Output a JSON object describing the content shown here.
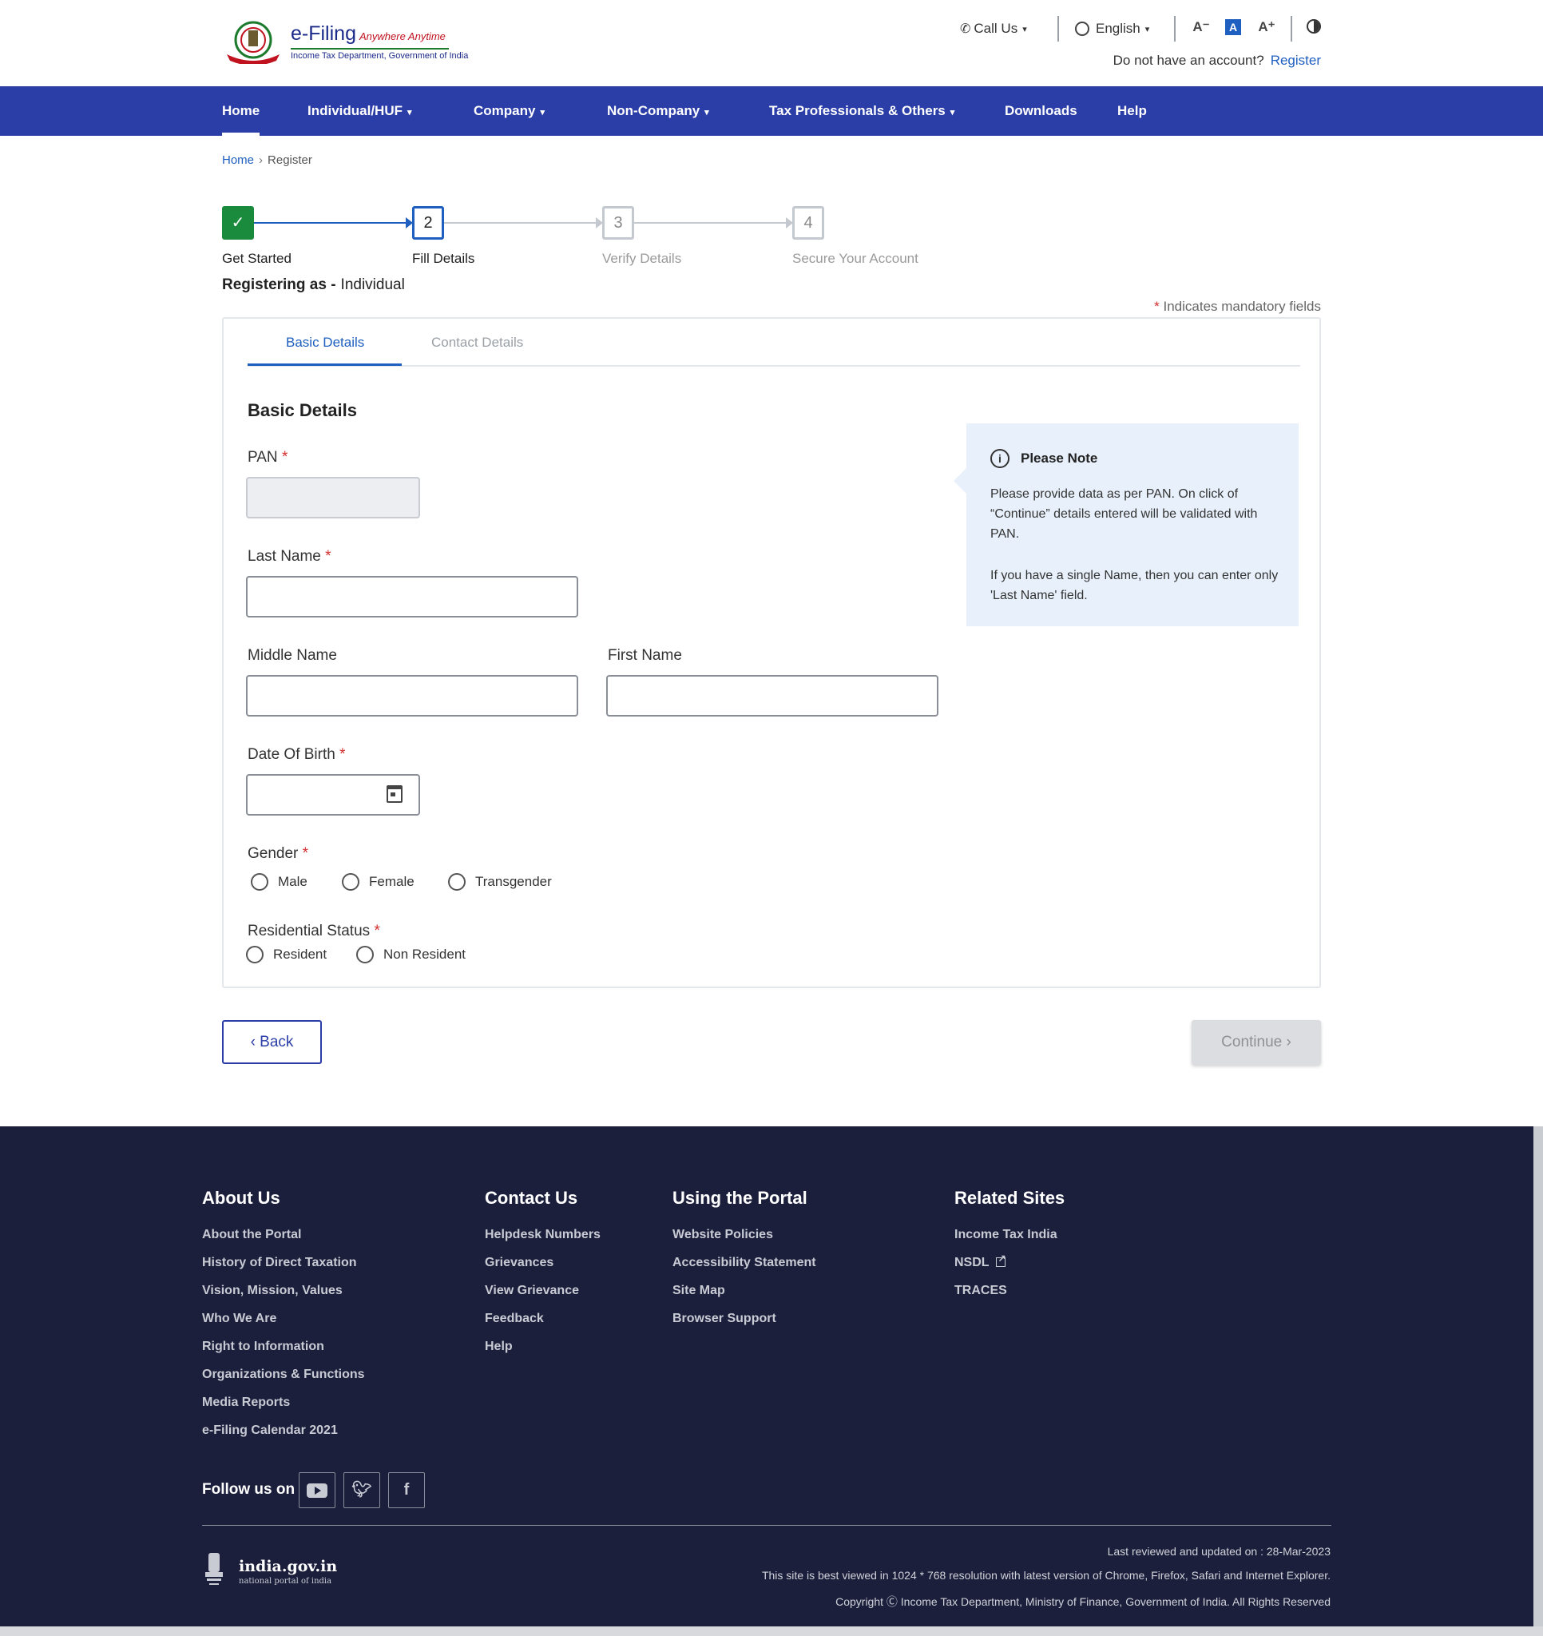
{
  "header": {
    "brand": "e-Filing",
    "tagline": "Anywhere Anytime",
    "subtitle": "Income Tax Department, Government of India",
    "call_us": "Call Us",
    "language": "English",
    "font_decrease": "A⁻",
    "font_normal": "A",
    "font_increase": "A⁺",
    "account_prompt": "Do not have an account?",
    "register_link": "Register"
  },
  "nav": {
    "items": [
      {
        "label": "Home",
        "active": true
      },
      {
        "label": "Individual/HUF",
        "dropdown": true
      },
      {
        "label": "Company",
        "dropdown": true
      },
      {
        "label": "Non-Company",
        "dropdown": true
      },
      {
        "label": "Tax Professionals & Others",
        "dropdown": true
      },
      {
        "label": "Downloads"
      },
      {
        "label": "Help"
      }
    ]
  },
  "breadcrumb": {
    "home": "Home",
    "separator": "›",
    "current": "Register"
  },
  "stepper": {
    "steps": [
      {
        "number": "✓",
        "label": "Get Started",
        "state": "done"
      },
      {
        "number": "2",
        "label": "Fill Details",
        "state": "current"
      },
      {
        "number": "3",
        "label": "Verify Details",
        "state": "pending"
      },
      {
        "number": "4",
        "label": "Secure Your Account",
        "state": "pending"
      }
    ]
  },
  "registering": {
    "prefix": "Registering as -",
    "type": "Individual"
  },
  "mandatory_note": {
    "star": "*",
    "text": "Indicates mandatory fields"
  },
  "tabs": {
    "basic": "Basic Details",
    "contact": "Contact Details"
  },
  "form": {
    "section_title": "Basic Details",
    "required_star": "*",
    "pan_label": "PAN",
    "pan_value": "",
    "last_name_label": "Last Name",
    "last_name_value": "",
    "middle_name_label": "Middle Name",
    "middle_name_value": "",
    "first_name_label": "First Name",
    "first_name_value": "",
    "dob_label": "Date Of Birth",
    "dob_value": "",
    "gender_label": "Gender",
    "gender_options": [
      "Male",
      "Female",
      "Transgender"
    ],
    "residential_label": "Residential Status",
    "residential_options": [
      "Resident",
      "Non Resident"
    ]
  },
  "note": {
    "icon": "i",
    "title": "Please Note",
    "p1": "Please provide data as per PAN. On click of “Continue” details entered will be validated with PAN.",
    "p2": "If you have a single Name, then you can enter only 'Last Name' field."
  },
  "buttons": {
    "back": "‹  Back",
    "continue": "Continue  ›"
  },
  "footer": {
    "about": {
      "title": "About Us",
      "links": [
        "About the Portal",
        "History of Direct Taxation",
        "Vision, Mission, Values",
        "Who We Are",
        "Right to Information",
        "Organizations & Functions",
        "Media Reports",
        "e-Filing Calendar 2021"
      ]
    },
    "contact": {
      "title": "Contact Us",
      "links": [
        "Helpdesk Numbers",
        "Grievances",
        "View Grievance",
        "Feedback",
        "Help"
      ]
    },
    "portal": {
      "title": "Using the Portal",
      "links": [
        "Website Policies",
        "Accessibility Statement",
        "Site Map",
        "Browser Support"
      ]
    },
    "related": {
      "title": "Related Sites",
      "links": [
        "Income Tax India",
        "NSDL",
        "TRACES"
      ]
    },
    "follow": "Follow us on",
    "social": [
      "youtube-icon",
      "twitter-icon",
      "facebook-icon"
    ],
    "india_title": "india.gov.in",
    "india_sub": "national portal of india",
    "last_reviewed": "Last reviewed and updated on : 28-Mar-2023",
    "best_viewed": "This site is best viewed in 1024 * 768 resolution with latest version of Chrome, Firefox, Safari and Internet Explorer.",
    "copyright": "Copyright Ⓒ Income Tax Department, Ministry of Finance, Government of India. All Rights Reserved"
  },
  "colors": {
    "primary": "#2b3ea8",
    "accent": "#1e5fbf",
    "success": "#1a8a3d",
    "required": "#d32f2f",
    "footer": "#1c1f3c"
  }
}
